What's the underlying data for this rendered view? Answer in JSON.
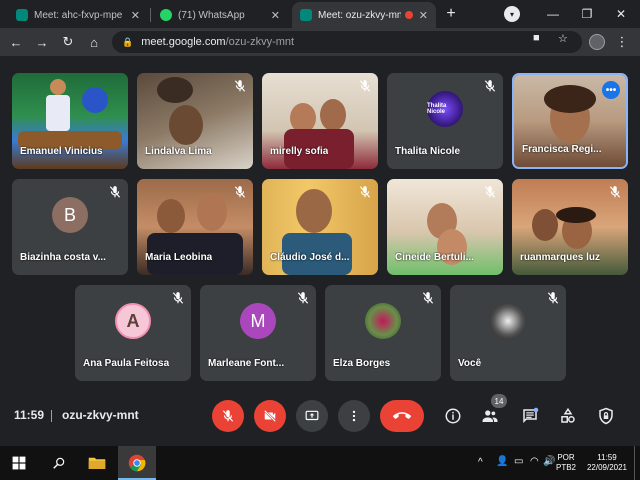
{
  "browser": {
    "tabs": [
      {
        "title": "Meet: ahc-fxvp-mpe"
      },
      {
        "title": "(71) WhatsApp"
      },
      {
        "title": "Meet: ozu-zkvy-mnt"
      }
    ],
    "url_host": "meet.google.com",
    "url_path": "/ozu-zkvy-mnt"
  },
  "participants": [
    {
      "name": "Emanuel Vinicius"
    },
    {
      "name": "Lindalva Lima"
    },
    {
      "name": "mirelly sofia"
    },
    {
      "name": "Thalita Nicole",
      "avatar_text": "Thalita Nicole"
    },
    {
      "name": "Francisca Regi..."
    },
    {
      "name": "Biazinha costa v...",
      "initial": "B"
    },
    {
      "name": "Maria Leobina"
    },
    {
      "name": "Cláudio José d..."
    },
    {
      "name": "Cineide Bertuli..."
    },
    {
      "name": "ruanmarques luz"
    },
    {
      "name": "Ana Paula Feitosa",
      "initial": "A"
    },
    {
      "name": "Marleane Font...",
      "initial": "M"
    },
    {
      "name": "Elza Borges"
    },
    {
      "name": "Você"
    }
  ],
  "meeting": {
    "time": "11:59",
    "code": "ozu-zkvy-mnt",
    "participant_count": "14"
  },
  "taskbar": {
    "lang_line1": "POR",
    "lang_line2": "PTB2",
    "clock_time": "11:59",
    "clock_date": "22/09/2021"
  },
  "colors": {
    "meet_red": "#ea4335",
    "active_border": "#8ab4f8",
    "tile_bg": "#3c4043"
  }
}
